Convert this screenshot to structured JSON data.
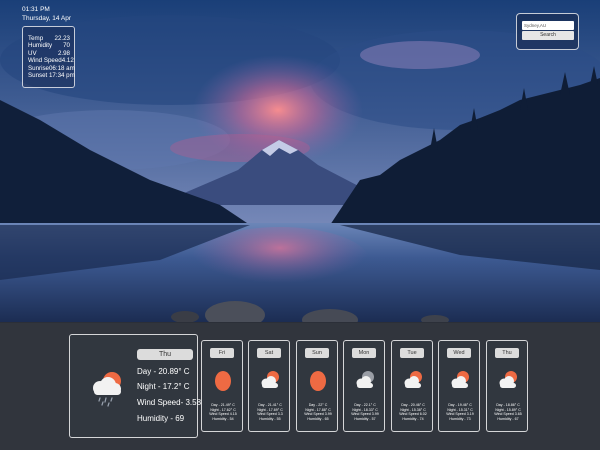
{
  "clock": {
    "time": "01:31 PM",
    "date": "Thursday, 14 Apr"
  },
  "stats": [
    {
      "label": "Temp",
      "value": "22.23"
    },
    {
      "label": "Humidity",
      "value": "70"
    },
    {
      "label": "UV",
      "value": "2.98"
    },
    {
      "label": "Wind Speed",
      "value": "4.12"
    }
  ],
  "sunrise": "Sunrise06:18 am",
  "sunset": "Sunset 17:34 pm",
  "search": {
    "value": "Sydney,AU",
    "button_label": "Search"
  },
  "today": {
    "day": "Thu",
    "icon": "cloud-rain-sun-icon",
    "day_temp": "Day - 20.89° C",
    "night_temp": "Night - 17.2° C",
    "wind": "Wind Speed- 3.58",
    "humidity": "Humidity - 69"
  },
  "forecast": [
    {
      "day": "Fri",
      "icon": "sun-icon",
      "day_temp": "Day - 21.49° C",
      "night_temp": "Night - 17.62° C",
      "wind": "Wind Speed 4.15",
      "humidity": "Humidity - 54"
    },
    {
      "day": "Sat",
      "icon": "cloud-sun-icon",
      "day_temp": "Day - 21.41° C",
      "night_temp": "Night - 17.69° C",
      "wind": "Wind Speed 3.3",
      "humidity": "Humidity - 55"
    },
    {
      "day": "Sun",
      "icon": "sun-icon",
      "day_temp": "Day - 22° C",
      "night_temp": "Night - 17.88° C",
      "wind": "Wind Speed 3.99",
      "humidity": "Humidity - 65"
    },
    {
      "day": "Mon",
      "icon": "cloud-sun-gray-icon",
      "day_temp": "Day - 22.1° C",
      "night_temp": "Night - 18.33° C",
      "wind": "Wind Speed 3.99",
      "humidity": "Humidity - 57"
    },
    {
      "day": "Tue",
      "icon": "cloud-sun-icon",
      "day_temp": "Day - 20.46° C",
      "night_temp": "Night - 15.38° C",
      "wind": "Wind Speed 6.02",
      "humidity": "Humidity - 74"
    },
    {
      "day": "Wed",
      "icon": "cloud-sun-icon",
      "day_temp": "Day - 19.46° C",
      "night_temp": "Night - 15.31° C",
      "wind": "Wind Speed 3.19",
      "humidity": "Humidity - 73"
    },
    {
      "day": "Thu",
      "icon": "cloud-sun-icon",
      "day_temp": "Day - 18.86° C",
      "night_temp": "Night - 15.89° C",
      "wind": "Wind Speed 3.65",
      "humidity": "Humidity - 67"
    }
  ],
  "colors": {
    "sun": "#ee6a43",
    "panel": "#363a42",
    "pill": "#dcdcdc"
  }
}
